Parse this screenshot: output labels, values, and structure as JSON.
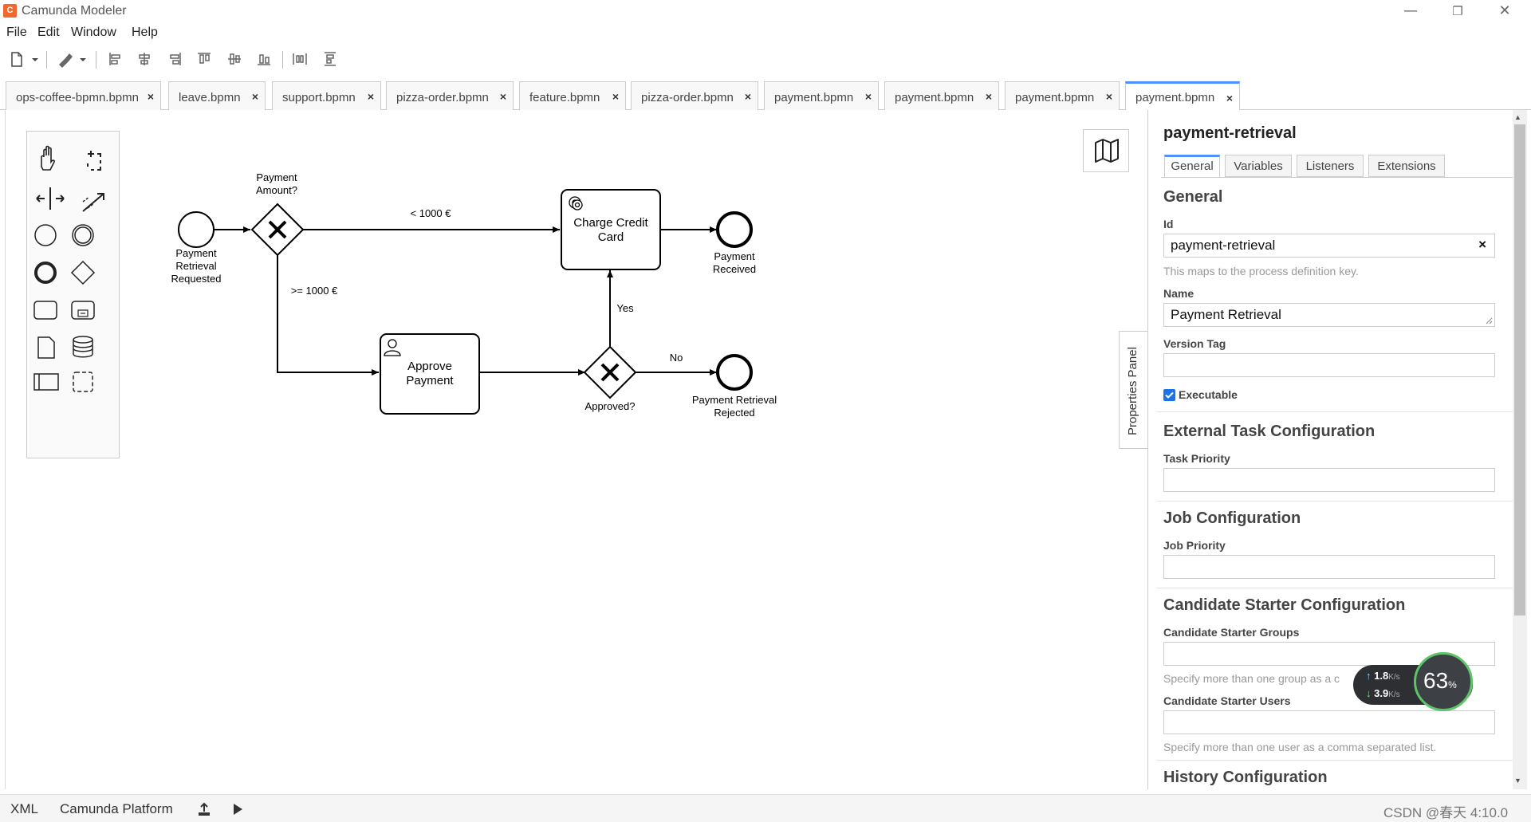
{
  "window": {
    "title": "Camunda Modeler",
    "logo": "camunda-logo"
  },
  "menu": [
    "File",
    "Edit",
    "Window",
    "Help"
  ],
  "tabs": [
    {
      "label": "ops-coffee-bpmn.bpmn",
      "active": false
    },
    {
      "label": "leave.bpmn",
      "active": false
    },
    {
      "label": "support.bpmn",
      "active": false
    },
    {
      "label": "pizza-order.bpmn",
      "active": false
    },
    {
      "label": "feature.bpmn",
      "active": false
    },
    {
      "label": "pizza-order.bpmn",
      "active": false
    },
    {
      "label": "payment.bpmn",
      "active": false
    },
    {
      "label": "payment.bpmn",
      "active": false
    },
    {
      "label": "payment.bpmn",
      "active": false
    },
    {
      "label": "payment.bpmn",
      "active": true
    }
  ],
  "tab_close_glyph": "×",
  "diagram": {
    "start_event": "Payment Retrieval Requested",
    "gateway_amount": "Payment Amount?",
    "flow_lt": "< 1000 €",
    "flow_gte": ">= 1000 €",
    "task_charge": "Charge Credit Card",
    "task_approve": "Approve Payment",
    "gateway_approved": "Approved?",
    "flow_yes": "Yes",
    "flow_no": "No",
    "end_received": "Payment Received",
    "end_rejected": "Payment Retrieval Rejected"
  },
  "properties": {
    "toggle_label": "Properties Panel",
    "title": "payment-retrieval",
    "tabs": [
      "General",
      "Variables",
      "Listeners",
      "Extensions"
    ],
    "general_title": "General",
    "id_label": "Id",
    "id_value": "payment-retrieval",
    "id_clear": "×",
    "id_hint": "This maps to the process definition key.",
    "name_label": "Name",
    "name_value": "Payment Retrieval",
    "version_label": "Version Tag",
    "version_value": "",
    "executable_label": "Executable",
    "executable_checked": true,
    "external_title": "External Task Configuration",
    "task_priority_label": "Task Priority",
    "job_title": "Job Configuration",
    "job_priority_label": "Job Priority",
    "candidate_title": "Candidate Starter Configuration",
    "candidate_groups_label": "Candidate Starter Groups",
    "candidate_groups_hint": "Specify more than one group as a c",
    "candidate_users_label": "Candidate Starter Users",
    "candidate_users_hint": "Specify more than one user as a comma separated list.",
    "history_title": "History Configuration"
  },
  "statusbar": {
    "xml": "XML",
    "platform": "Camunda Platform",
    "right_text": "CSDN @春天 4:10.0"
  },
  "network_widget": {
    "up": "1.8",
    "down": "3.9",
    "unit": "K/s",
    "percent": "63",
    "percent_sign": "%"
  },
  "colors": {
    "accent": "#4d90fe",
    "logo": "#f0682c",
    "widget_ring": "#5fc36a"
  }
}
